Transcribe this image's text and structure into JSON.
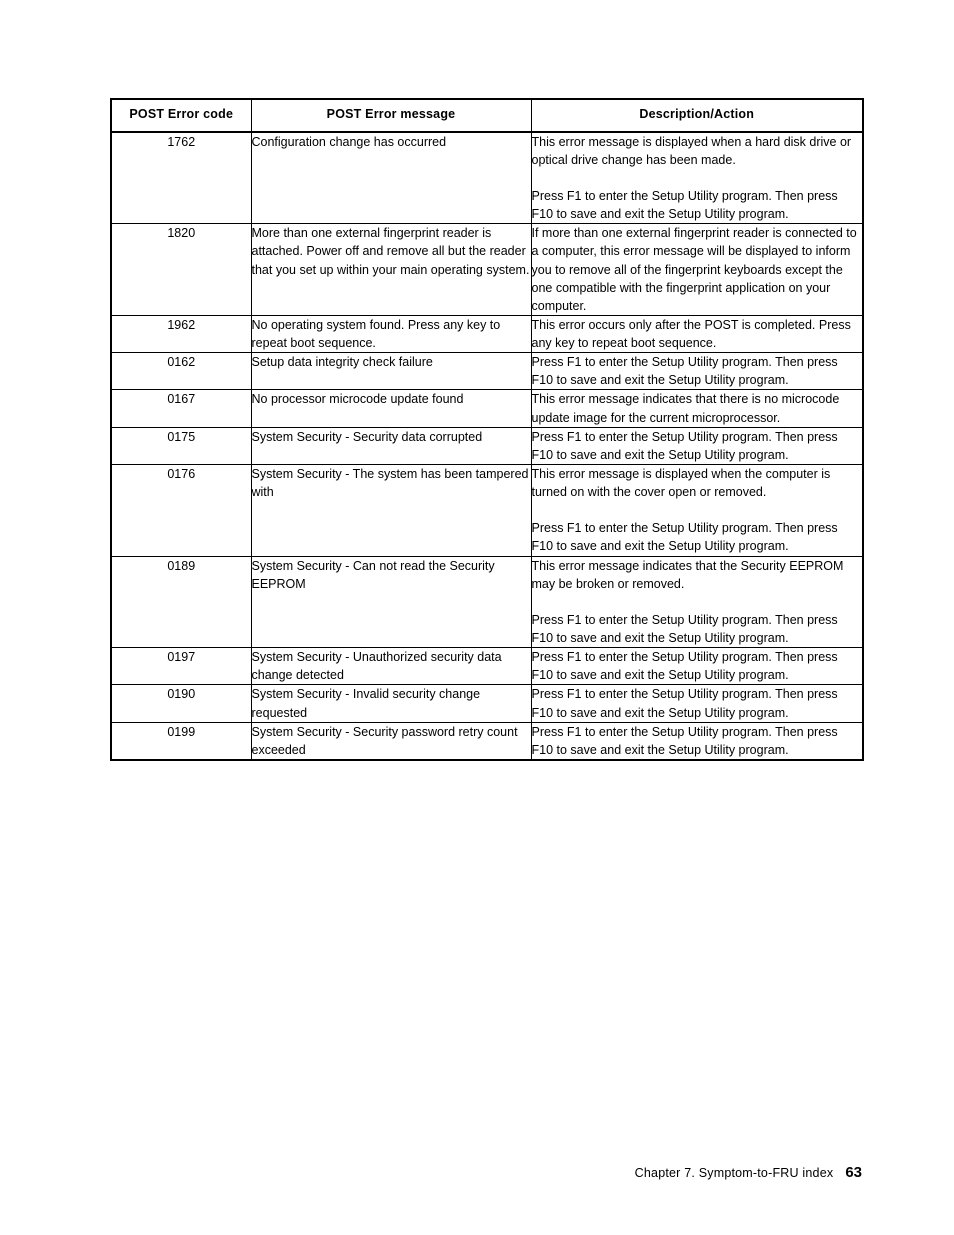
{
  "table": {
    "headers": {
      "code": "POST Error code",
      "message": "POST Error message",
      "description": "Description/Action"
    },
    "rows": [
      {
        "code": "1762",
        "message": "Configuration change has occurred",
        "description": [
          "This error message is displayed when a hard disk drive or optical drive change has been made.",
          "Press F1 to enter the Setup Utility program. Then press F10 to save and exit the Setup Utility program."
        ]
      },
      {
        "code": "1820",
        "message": "More than one external fingerprint reader is attached. Power off and remove all but the reader that you set up within your main operating system.",
        "description": [
          "If more than one external fingerprint reader is connected to a computer, this error message will be displayed to inform you to remove all of the fingerprint keyboards except the one compatible with the fingerprint application on your computer."
        ]
      },
      {
        "code": "1962",
        "message": "No operating system found. Press any key to repeat boot sequence.",
        "description": [
          "This error occurs only after the POST is completed. Press any key to repeat boot sequence."
        ]
      },
      {
        "code": "0162",
        "message": "Setup data integrity check failure",
        "description": [
          "Press F1 to enter the Setup Utility program. Then press F10 to save and exit the Setup Utility program."
        ]
      },
      {
        "code": "0167",
        "message": "No processor microcode update found",
        "description": [
          "This error message indicates that there is no microcode update image for the current microprocessor."
        ]
      },
      {
        "code": "0175",
        "message": "System Security - Security data corrupted",
        "description": [
          "Press F1 to enter the Setup Utility program. Then press F10 to save and exit the Setup Utility program."
        ]
      },
      {
        "code": "0176",
        "message": "System Security - The system has been tampered with",
        "description": [
          "This error message is displayed when the computer is turned on with the cover open or removed.",
          "Press F1 to enter the Setup Utility program. Then press F10 to save and exit the Setup Utility program."
        ]
      },
      {
        "code": "0189",
        "message": "System Security - Can not read the Security EEPROM",
        "description": [
          "This error message indicates that the Security EEPROM may be broken or removed.",
          "Press F1 to enter the Setup Utility program. Then press F10 to save and exit the Setup Utility program."
        ]
      },
      {
        "code": "0197",
        "message": "System Security - Unauthorized security data change detected",
        "description": [
          "Press F1 to enter the Setup Utility program. Then press F10 to save and exit the Setup Utility program."
        ]
      },
      {
        "code": "0190",
        "message": "System Security - Invalid security change requested",
        "description": [
          "Press F1 to enter the Setup Utility program. Then press F10 to save and exit the Setup Utility program."
        ]
      },
      {
        "code": "0199",
        "message": "System Security - Security password retry count exceeded",
        "description": [
          "Press F1 to enter the Setup Utility program. Then press F10 to save and exit the Setup Utility program."
        ]
      }
    ]
  },
  "footer": {
    "chapter": "Chapter 7. Symptom-to-FRU index",
    "page_number": "63"
  }
}
